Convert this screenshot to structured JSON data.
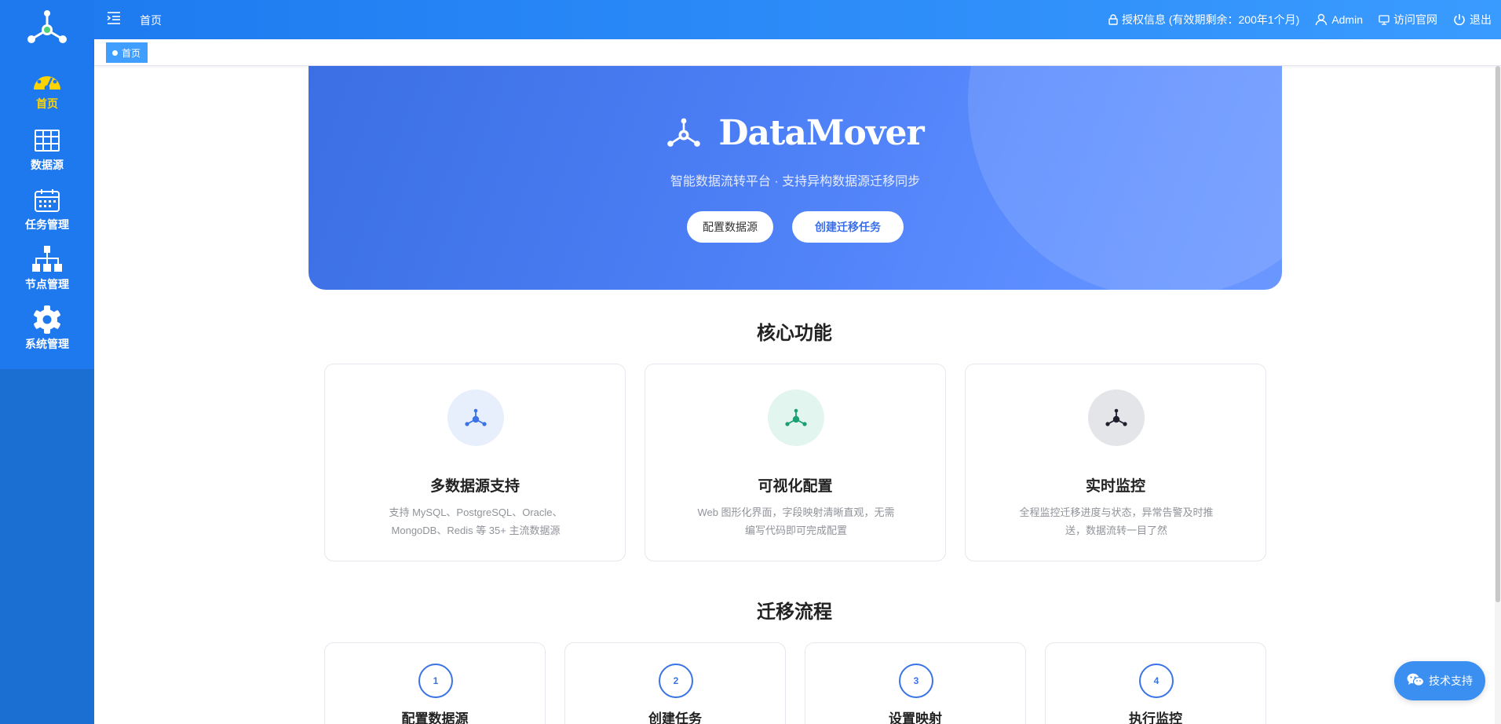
{
  "sidebar": {
    "items": [
      {
        "label": "首页",
        "icon": "dashboard-gauge-icon",
        "active": true
      },
      {
        "label": "数据源",
        "icon": "table-grid-icon",
        "active": false
      },
      {
        "label": "任务管理",
        "icon": "calendar-icon",
        "active": false
      },
      {
        "label": "节点管理",
        "icon": "org-tree-icon",
        "active": false
      },
      {
        "label": "系统管理",
        "icon": "gear-icon",
        "active": false
      }
    ],
    "active_color": "#ffd400"
  },
  "header": {
    "breadcrumb": "首页",
    "license": "授权信息 (有效期剩余：200年1个月)",
    "user": "Admin",
    "visit_site": "访问官网",
    "logout": "退出"
  },
  "tags": [
    {
      "label": "首页",
      "active": true
    }
  ],
  "hero": {
    "title": "DataMover",
    "subtitle": "智能数据流转平台 · 支持异构数据源迁移同步",
    "btn_config": "配置数据源",
    "btn_create": "创建迁移任务"
  },
  "features": {
    "title": "核心功能",
    "items": [
      {
        "title": "多数据源支持",
        "desc": "支持 MySQL、PostgreSQL、Oracle、MongoDB、Redis 等 35+ 主流数据源",
        "icon_color": "#3a73e6",
        "icon_bg": "#e8effc"
      },
      {
        "title": "可视化配置",
        "desc": "Web 图形化界面，字段映射清晰直观，无需编写代码即可完成配置",
        "icon_color": "#1aa071",
        "icon_bg": "#e2f5ee"
      },
      {
        "title": "实时监控",
        "desc": "全程监控迁移进度与状态，异常告警及时推送，数据流转一目了然",
        "icon_color": "#1f1f2e",
        "icon_bg": "#e4e5e8"
      }
    ]
  },
  "steps": {
    "title": "迁移流程",
    "items": [
      {
        "num": "1",
        "title": "配置数据源"
      },
      {
        "num": "2",
        "title": "创建任务"
      },
      {
        "num": "3",
        "title": "设置映射"
      },
      {
        "num": "4",
        "title": "执行监控"
      }
    ]
  },
  "support": {
    "label": "技术支持",
    "icon": "wechat-icon"
  },
  "colors": {
    "primary": "#1e78ee",
    "header_end": "#3a9bff",
    "tag": "#409eff"
  }
}
